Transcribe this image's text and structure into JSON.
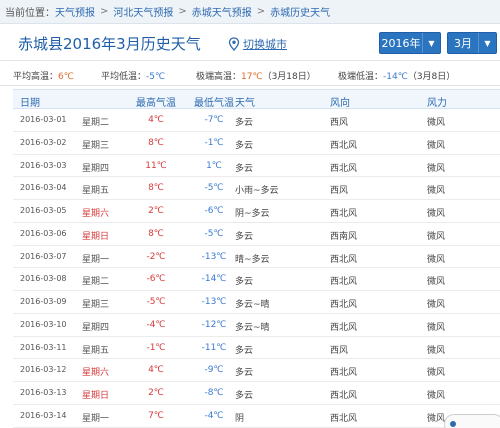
{
  "breadcrumb": {
    "prefix": "当前位置：",
    "items": [
      "天气预报",
      "河北天气预报",
      "赤城天气预报",
      "赤城历史天气"
    ],
    "separator": ">"
  },
  "header": {
    "title": "赤城县2016年3月历史天气",
    "switch_city": "切换城市",
    "year_value": "2016年",
    "month_value": "3月"
  },
  "stats": {
    "avg_high_label": "平均高温：",
    "avg_high_value": "6℃",
    "avg_low_label": "平均低温：",
    "avg_low_value": "-5℃",
    "max_high_label": "极端高温：",
    "max_high_value": "17℃",
    "max_high_date": "（3月18日）",
    "min_low_label": "极端低温：",
    "min_low_value": "-14℃",
    "min_low_date": "（3月8日）"
  },
  "table": {
    "headers": [
      "日期",
      "最高气温",
      "最低气温",
      "天气",
      "风向",
      "风力"
    ],
    "rows": [
      {
        "date": "2016-03-01",
        "weekday": "星期二",
        "weekend": false,
        "high": "4℃",
        "low": "-7℃",
        "weather": "多云",
        "wind_dir": "西风",
        "wind_power": "微风"
      },
      {
        "date": "2016-03-02",
        "weekday": "星期三",
        "weekend": false,
        "high": "8℃",
        "low": "-1℃",
        "weather": "多云",
        "wind_dir": "西北风",
        "wind_power": "微风"
      },
      {
        "date": "2016-03-03",
        "weekday": "星期四",
        "weekend": false,
        "high": "11℃",
        "low": "1℃",
        "weather": "多云",
        "wind_dir": "西北风",
        "wind_power": "微风"
      },
      {
        "date": "2016-03-04",
        "weekday": "星期五",
        "weekend": false,
        "high": "8℃",
        "low": "-5℃",
        "weather": "小雨~多云",
        "wind_dir": "西风",
        "wind_power": "微风"
      },
      {
        "date": "2016-03-05",
        "weekday": "星期六",
        "weekend": true,
        "high": "2℃",
        "low": "-6℃",
        "weather": "阴~多云",
        "wind_dir": "西北风",
        "wind_power": "微风"
      },
      {
        "date": "2016-03-06",
        "weekday": "星期日",
        "weekend": true,
        "high": "8℃",
        "low": "-5℃",
        "weather": "多云",
        "wind_dir": "西南风",
        "wind_power": "微风"
      },
      {
        "date": "2016-03-07",
        "weekday": "星期一",
        "weekend": false,
        "high": "-2℃",
        "low": "-13℃",
        "weather": "晴~多云",
        "wind_dir": "西北风",
        "wind_power": "微风"
      },
      {
        "date": "2016-03-08",
        "weekday": "星期二",
        "weekend": false,
        "high": "-6℃",
        "low": "-14℃",
        "weather": "多云",
        "wind_dir": "西北风",
        "wind_power": "微风"
      },
      {
        "date": "2016-03-09",
        "weekday": "星期三",
        "weekend": false,
        "high": "-5℃",
        "low": "-13℃",
        "weather": "多云~晴",
        "wind_dir": "西北风",
        "wind_power": "微风"
      },
      {
        "date": "2016-03-10",
        "weekday": "星期四",
        "weekend": false,
        "high": "-4℃",
        "low": "-12℃",
        "weather": "多云~晴",
        "wind_dir": "西北风",
        "wind_power": "微风"
      },
      {
        "date": "2016-03-11",
        "weekday": "星期五",
        "weekend": false,
        "high": "-1℃",
        "low": "-11℃",
        "weather": "多云",
        "wind_dir": "西风",
        "wind_power": "微风"
      },
      {
        "date": "2016-03-12",
        "weekday": "星期六",
        "weekend": true,
        "high": "4℃",
        "low": "-9℃",
        "weather": "多云",
        "wind_dir": "西北风",
        "wind_power": "微风"
      },
      {
        "date": "2016-03-13",
        "weekday": "星期日",
        "weekend": true,
        "high": "2℃",
        "low": "-8℃",
        "weather": "多云",
        "wind_dir": "西北风",
        "wind_power": "微风"
      },
      {
        "date": "2016-03-14",
        "weekday": "星期一",
        "weekend": false,
        "high": "7℃",
        "low": "-4℃",
        "weather": "阴",
        "wind_dir": "西北风",
        "wind_power": "微风"
      }
    ]
  },
  "colors": {
    "accent_blue": "#2e6ab0",
    "high_temp_red": "#d63a3a",
    "low_temp_blue": "#3a7ad0",
    "stat_orange": "#e06c2a",
    "dropdown_bg": "#2b74c0"
  },
  "icons": {
    "switch_city": "map-pin-icon",
    "dropdown": "caret-down-icon"
  }
}
